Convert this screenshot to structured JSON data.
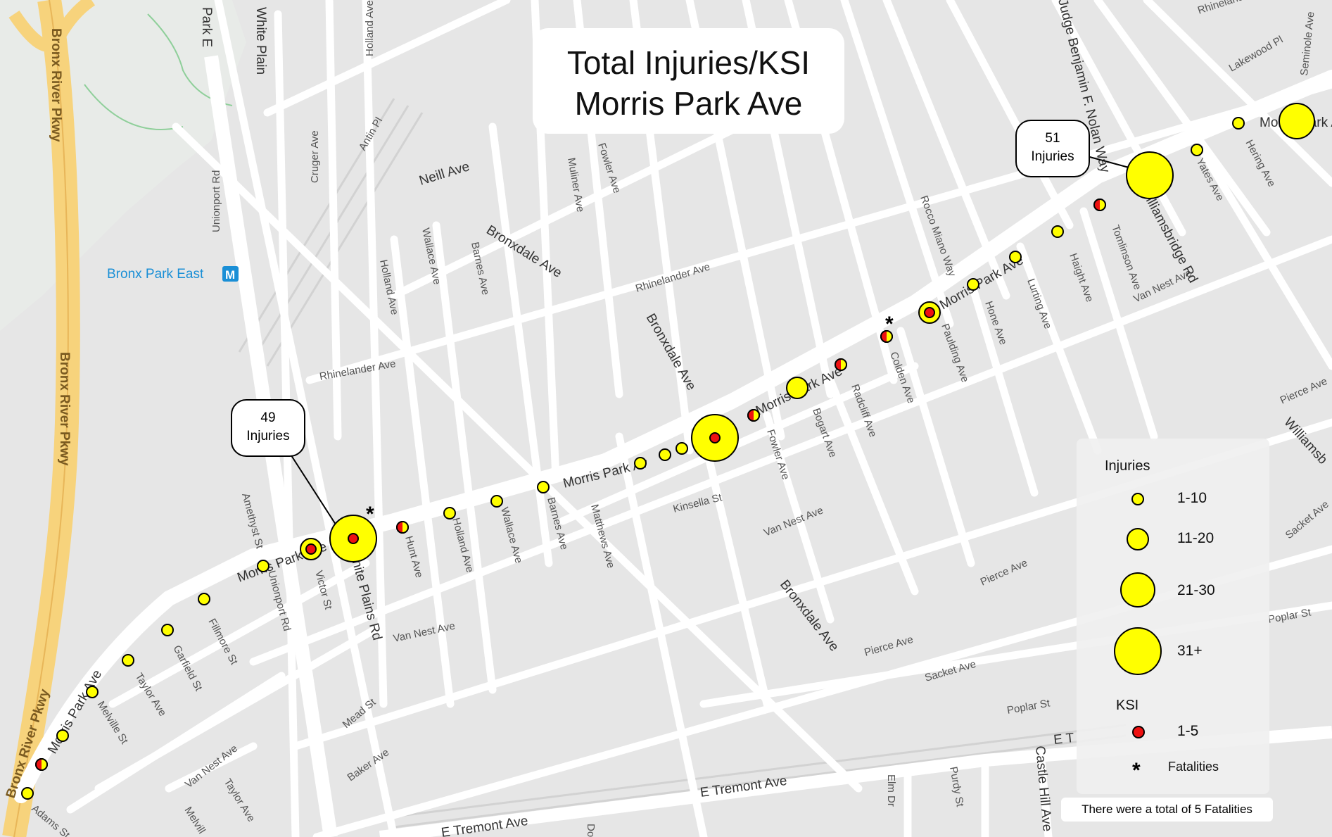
{
  "title": {
    "line1": "Total Injuries/KSI",
    "line2": "Morris Park Ave"
  },
  "callouts": [
    {
      "count": "49",
      "unit": "Injuries"
    },
    {
      "count": "51",
      "unit": "Injuries"
    }
  ],
  "legend": {
    "injuries_heading": "Injuries",
    "injury_classes": [
      "1-10",
      "11-20",
      "21-30",
      "31+"
    ],
    "ksi_heading": "KSI",
    "ksi_class": "1-5",
    "fatalities_symbol": "*",
    "fatalities_label": "Fatalities"
  },
  "note": "There were a total of  5 Fatalities",
  "transit": {
    "station": "Bronx Park East",
    "badge": "M"
  },
  "streets": {
    "bronx_river_pkwy": "Bronx River Pkwy",
    "park_e": "Park E",
    "white_plains": "White Plains Rd",
    "white_plain_top": "White Plain",
    "holland": "Holland Ave",
    "antin": "Antin Pl",
    "neill": "Neill Ave",
    "cruger": "Cruger Ave",
    "unionport": "Unionport Rd",
    "wallace": "Wallace Ave",
    "barnes": "Barnes Ave",
    "muliner": "Muliner Ave",
    "fowler": "Fowler Ave",
    "bronxdale": "Bronxdale Ave",
    "rhinelander": "Rhinelander Ave",
    "morris_park": "Morris Park Ave",
    "morris_park_short": "Morris Park Av",
    "kinsella": "Kinsella St",
    "van_nest": "Van Nest Ave",
    "matthews": "Matthews Ave",
    "hunt": "Hunt Ave",
    "victor": "Victor St",
    "amethyst": "Amethyst St",
    "fillmore": "Fillmore St",
    "garfield": "Garfield St",
    "taylor": "Taylor Ave",
    "melville": "Melville St",
    "adams": "Adams St",
    "mead": "Mead St",
    "baker": "Baker Ave",
    "e_tremont": "E Tremont Ave",
    "bogart": "Bogart Ave",
    "radcliff": "Radcliff Ave",
    "colden": "Colden Ave",
    "paulding": "Paulding Ave",
    "hone": "Hone Ave",
    "rocco": "Rocco Miano Way",
    "lurting": "Lurting Ave",
    "haight": "Haight Ave",
    "tomlinson": "Tomlinson Ave",
    "williamsbridge": "Williamsbridge Rd",
    "nolan": "Judge Benjamin F. Nolan Way",
    "yates": "Yates Ave",
    "hering": "Hering Ave",
    "lakewood": "Lakewood Pl",
    "seminole": "Seminole Ave",
    "pierce": "Pierce Ave",
    "sacket": "Sacket Ave",
    "poplar": "Poplar St",
    "castle_hill": "Castle Hill Ave",
    "elm": "Elm Dr",
    "purdy": "Purdy St",
    "e_t": "E T",
    "williamsb": "Williamsb",
    "doc": "Dod",
    "melvill": "Melvill"
  }
}
